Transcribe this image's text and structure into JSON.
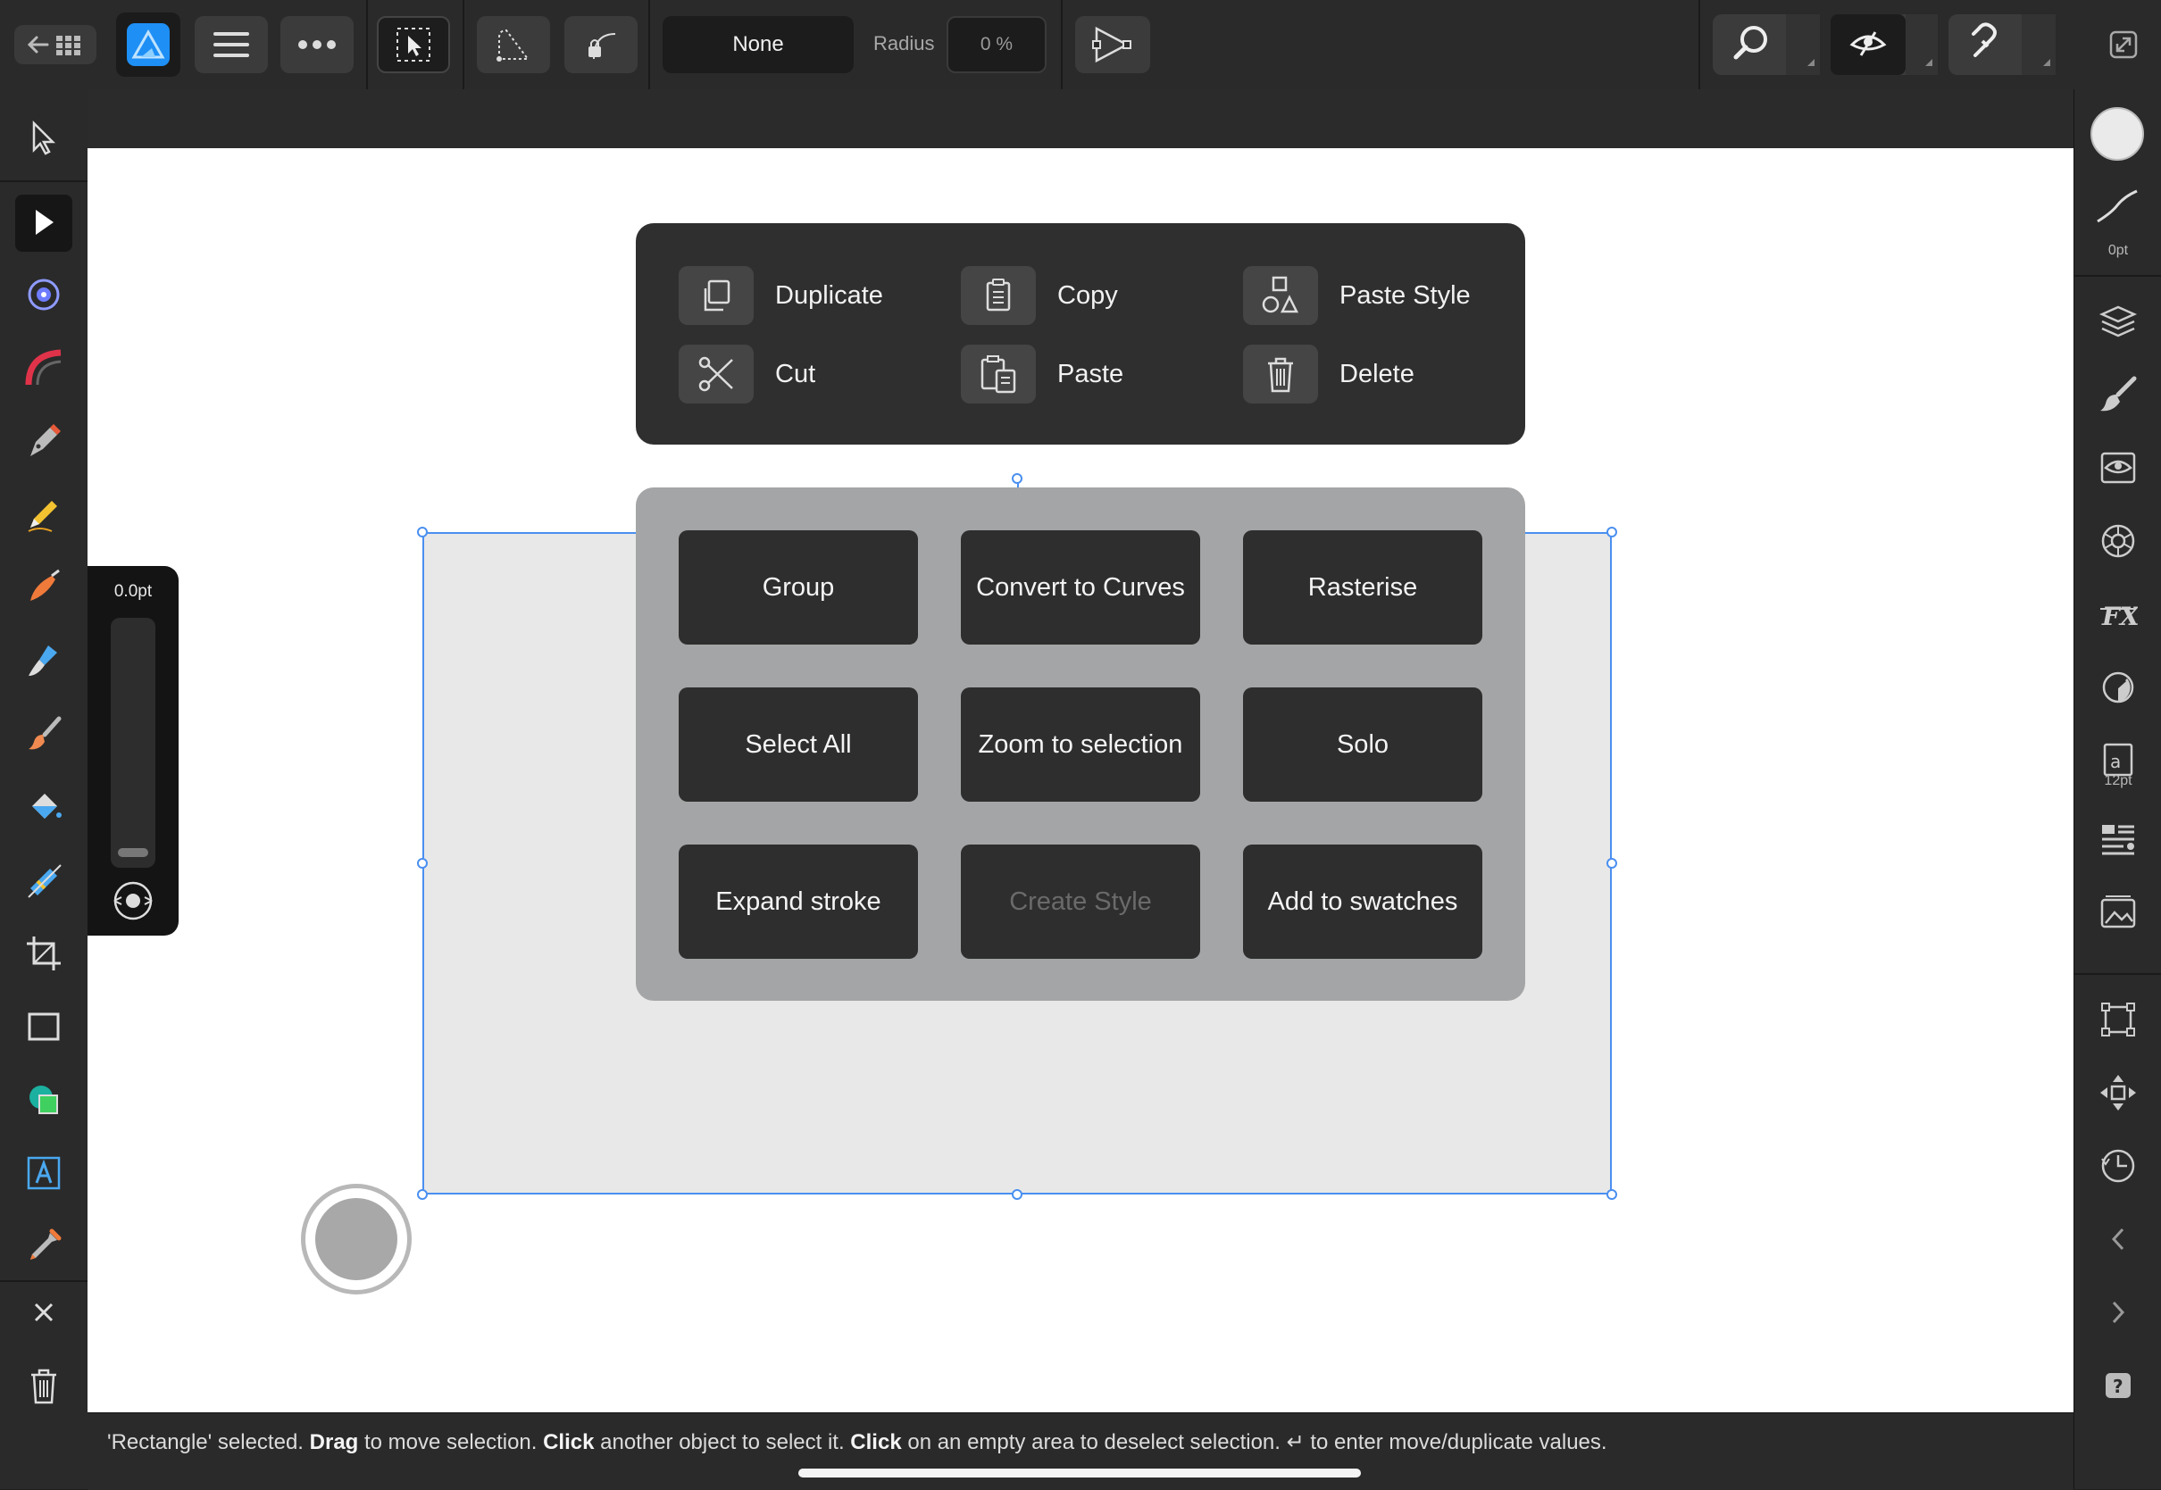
{
  "toolbar": {
    "back_icon": "back-to-gallery-icon",
    "fill_label": "None",
    "radius_label": "Radius",
    "radius_value": "0 %"
  },
  "context_menu": {
    "items": [
      {
        "label": "Duplicate",
        "icon": "duplicate-icon"
      },
      {
        "label": "Copy",
        "icon": "copy-icon"
      },
      {
        "label": "Paste Style",
        "icon": "paste-style-icon"
      },
      {
        "label": "Cut",
        "icon": "cut-icon"
      },
      {
        "label": "Paste",
        "icon": "paste-icon"
      },
      {
        "label": "Delete",
        "icon": "delete-icon"
      }
    ]
  },
  "actions": {
    "items": [
      {
        "label": "Group",
        "enabled": true
      },
      {
        "label": "Convert to Curves",
        "enabled": true
      },
      {
        "label": "Rasterise",
        "enabled": true
      },
      {
        "label": "Select All",
        "enabled": true
      },
      {
        "label": "Zoom to selection",
        "enabled": true
      },
      {
        "label": "Solo",
        "enabled": true
      },
      {
        "label": "Expand stroke",
        "enabled": true
      },
      {
        "label": "Create Style",
        "enabled": false
      },
      {
        "label": "Add to swatches",
        "enabled": true
      }
    ]
  },
  "brush_size": {
    "value": "0.0pt"
  },
  "right_panel": {
    "stroke_width": "0pt",
    "text_size": "12pt"
  },
  "status": {
    "p1": "'Rectangle' selected. ",
    "b1": "Drag",
    "p2": " to move selection. ",
    "b2": "Click",
    "p3": " another object to select it. ",
    "b3": "Click",
    "p4": " on an empty area to deselect selection. ↵ to enter move/duplicate values."
  },
  "colors": {
    "accent": "#4a8ff0",
    "app_blue": "#1e8ff5",
    "panel_dark": "#2f2f2f",
    "panel_grey": "#a4a5a7"
  }
}
